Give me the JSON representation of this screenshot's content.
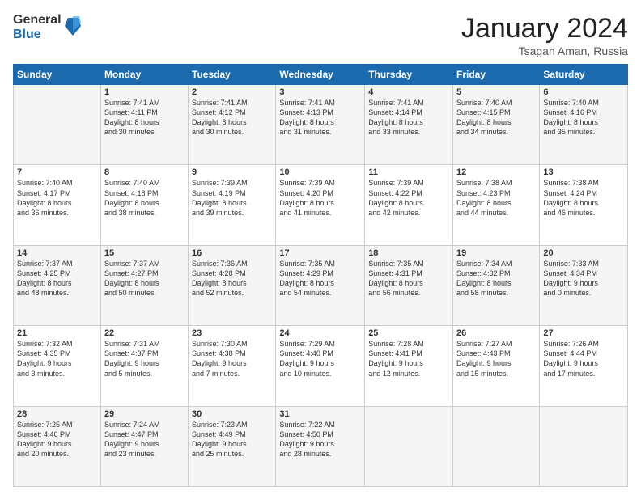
{
  "logo": {
    "general": "General",
    "blue": "Blue"
  },
  "title": "January 2024",
  "location": "Tsagan Aman, Russia",
  "days_header": [
    "Sunday",
    "Monday",
    "Tuesday",
    "Wednesday",
    "Thursday",
    "Friday",
    "Saturday"
  ],
  "weeks": [
    [
      {
        "day": "",
        "info": ""
      },
      {
        "day": "1",
        "info": "Sunrise: 7:41 AM\nSunset: 4:11 PM\nDaylight: 8 hours\nand 30 minutes."
      },
      {
        "day": "2",
        "info": "Sunrise: 7:41 AM\nSunset: 4:12 PM\nDaylight: 8 hours\nand 30 minutes."
      },
      {
        "day": "3",
        "info": "Sunrise: 7:41 AM\nSunset: 4:13 PM\nDaylight: 8 hours\nand 31 minutes."
      },
      {
        "day": "4",
        "info": "Sunrise: 7:41 AM\nSunset: 4:14 PM\nDaylight: 8 hours\nand 33 minutes."
      },
      {
        "day": "5",
        "info": "Sunrise: 7:40 AM\nSunset: 4:15 PM\nDaylight: 8 hours\nand 34 minutes."
      },
      {
        "day": "6",
        "info": "Sunrise: 7:40 AM\nSunset: 4:16 PM\nDaylight: 8 hours\nand 35 minutes."
      }
    ],
    [
      {
        "day": "7",
        "info": "Sunrise: 7:40 AM\nSunset: 4:17 PM\nDaylight: 8 hours\nand 36 minutes."
      },
      {
        "day": "8",
        "info": "Sunrise: 7:40 AM\nSunset: 4:18 PM\nDaylight: 8 hours\nand 38 minutes."
      },
      {
        "day": "9",
        "info": "Sunrise: 7:39 AM\nSunset: 4:19 PM\nDaylight: 8 hours\nand 39 minutes."
      },
      {
        "day": "10",
        "info": "Sunrise: 7:39 AM\nSunset: 4:20 PM\nDaylight: 8 hours\nand 41 minutes."
      },
      {
        "day": "11",
        "info": "Sunrise: 7:39 AM\nSunset: 4:22 PM\nDaylight: 8 hours\nand 42 minutes."
      },
      {
        "day": "12",
        "info": "Sunrise: 7:38 AM\nSunset: 4:23 PM\nDaylight: 8 hours\nand 44 minutes."
      },
      {
        "day": "13",
        "info": "Sunrise: 7:38 AM\nSunset: 4:24 PM\nDaylight: 8 hours\nand 46 minutes."
      }
    ],
    [
      {
        "day": "14",
        "info": "Sunrise: 7:37 AM\nSunset: 4:25 PM\nDaylight: 8 hours\nand 48 minutes."
      },
      {
        "day": "15",
        "info": "Sunrise: 7:37 AM\nSunset: 4:27 PM\nDaylight: 8 hours\nand 50 minutes."
      },
      {
        "day": "16",
        "info": "Sunrise: 7:36 AM\nSunset: 4:28 PM\nDaylight: 8 hours\nand 52 minutes."
      },
      {
        "day": "17",
        "info": "Sunrise: 7:35 AM\nSunset: 4:29 PM\nDaylight: 8 hours\nand 54 minutes."
      },
      {
        "day": "18",
        "info": "Sunrise: 7:35 AM\nSunset: 4:31 PM\nDaylight: 8 hours\nand 56 minutes."
      },
      {
        "day": "19",
        "info": "Sunrise: 7:34 AM\nSunset: 4:32 PM\nDaylight: 8 hours\nand 58 minutes."
      },
      {
        "day": "20",
        "info": "Sunrise: 7:33 AM\nSunset: 4:34 PM\nDaylight: 9 hours\nand 0 minutes."
      }
    ],
    [
      {
        "day": "21",
        "info": "Sunrise: 7:32 AM\nSunset: 4:35 PM\nDaylight: 9 hours\nand 3 minutes."
      },
      {
        "day": "22",
        "info": "Sunrise: 7:31 AM\nSunset: 4:37 PM\nDaylight: 9 hours\nand 5 minutes."
      },
      {
        "day": "23",
        "info": "Sunrise: 7:30 AM\nSunset: 4:38 PM\nDaylight: 9 hours\nand 7 minutes."
      },
      {
        "day": "24",
        "info": "Sunrise: 7:29 AM\nSunset: 4:40 PM\nDaylight: 9 hours\nand 10 minutes."
      },
      {
        "day": "25",
        "info": "Sunrise: 7:28 AM\nSunset: 4:41 PM\nDaylight: 9 hours\nand 12 minutes."
      },
      {
        "day": "26",
        "info": "Sunrise: 7:27 AM\nSunset: 4:43 PM\nDaylight: 9 hours\nand 15 minutes."
      },
      {
        "day": "27",
        "info": "Sunrise: 7:26 AM\nSunset: 4:44 PM\nDaylight: 9 hours\nand 17 minutes."
      }
    ],
    [
      {
        "day": "28",
        "info": "Sunrise: 7:25 AM\nSunset: 4:46 PM\nDaylight: 9 hours\nand 20 minutes."
      },
      {
        "day": "29",
        "info": "Sunrise: 7:24 AM\nSunset: 4:47 PM\nDaylight: 9 hours\nand 23 minutes."
      },
      {
        "day": "30",
        "info": "Sunrise: 7:23 AM\nSunset: 4:49 PM\nDaylight: 9 hours\nand 25 minutes."
      },
      {
        "day": "31",
        "info": "Sunrise: 7:22 AM\nSunset: 4:50 PM\nDaylight: 9 hours\nand 28 minutes."
      },
      {
        "day": "",
        "info": ""
      },
      {
        "day": "",
        "info": ""
      },
      {
        "day": "",
        "info": ""
      }
    ]
  ]
}
